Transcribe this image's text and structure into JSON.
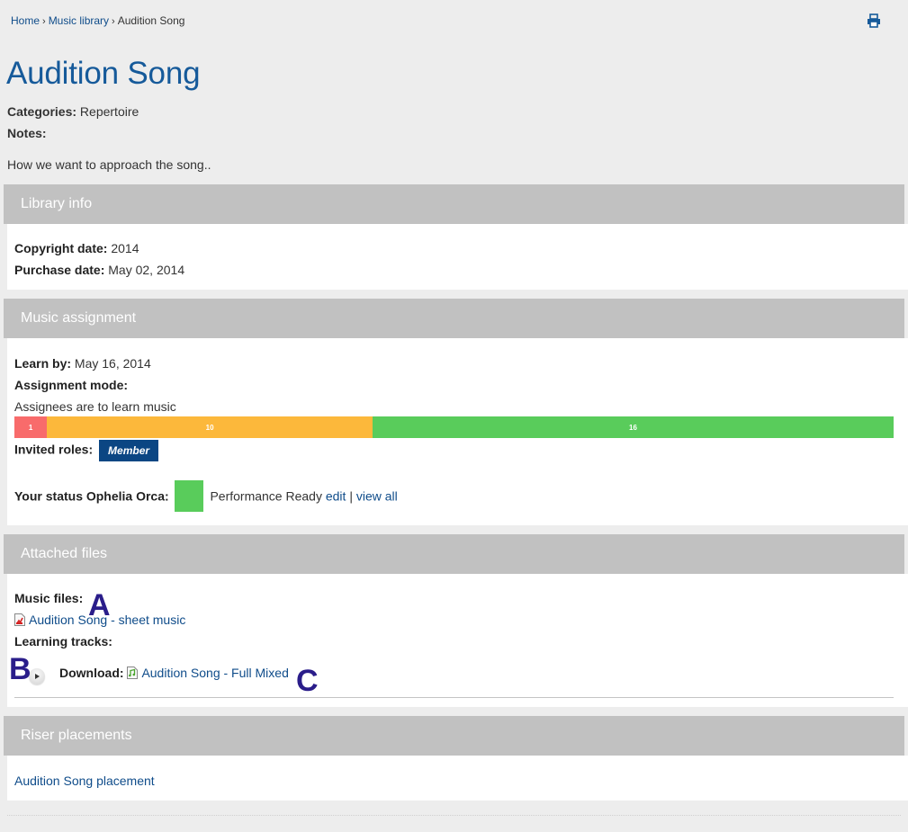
{
  "breadcrumb": {
    "items": [
      {
        "label": "Home",
        "link": true
      },
      {
        "label": "Music library",
        "link": true
      },
      {
        "label": "Audition Song",
        "link": false
      }
    ],
    "separator": "›"
  },
  "toolbar": {
    "print_icon": "print-icon"
  },
  "page": {
    "title": "Audition Song",
    "categories_label": "Categories:",
    "categories_value": "Repertoire",
    "notes_label": "Notes:",
    "notes_text": "How we want to approach the song.."
  },
  "library_info": {
    "title": "Library info",
    "copyright_label": "Copyright date:",
    "copyright_value": "2014",
    "purchase_label": "Purchase date:",
    "purchase_value": "May 02, 2014"
  },
  "music_assignment": {
    "title": "Music assignment",
    "learn_by_label": "Learn by:",
    "learn_by_value": "May 16, 2014",
    "mode_label": "Assignment mode:",
    "mode_value": "Assignees are to learn music",
    "progress": [
      {
        "label": "1",
        "value": 1,
        "color": "#f86b6b"
      },
      {
        "label": "10",
        "value": 10,
        "color": "#fcb83b"
      },
      {
        "label": "16",
        "value": 16,
        "color": "#59cc5b"
      }
    ],
    "invited_roles_label": "Invited roles:",
    "invited_roles": [
      "Member"
    ],
    "status_label": "Your status Ophelia Orca:",
    "status_color": "#59cc5b",
    "status_value": "Performance Ready",
    "edit_link": "edit",
    "separator": "|",
    "view_all_link": "view all"
  },
  "attached_files": {
    "title": "Attached files",
    "music_files_label": "Music files:",
    "music_files": [
      {
        "name": "Audition Song - sheet music",
        "icon": "pdf-file-icon"
      }
    ],
    "learning_tracks_label": "Learning tracks:",
    "download_label": "Download:",
    "tracks": [
      {
        "name": "Audition Song - Full Mixed",
        "icon": "audio-file-icon"
      }
    ]
  },
  "riser_placements": {
    "title": "Riser placements",
    "items": [
      "Audition Song placement"
    ]
  },
  "annotations": {
    "a": "A",
    "b": "B",
    "c": "C"
  }
}
